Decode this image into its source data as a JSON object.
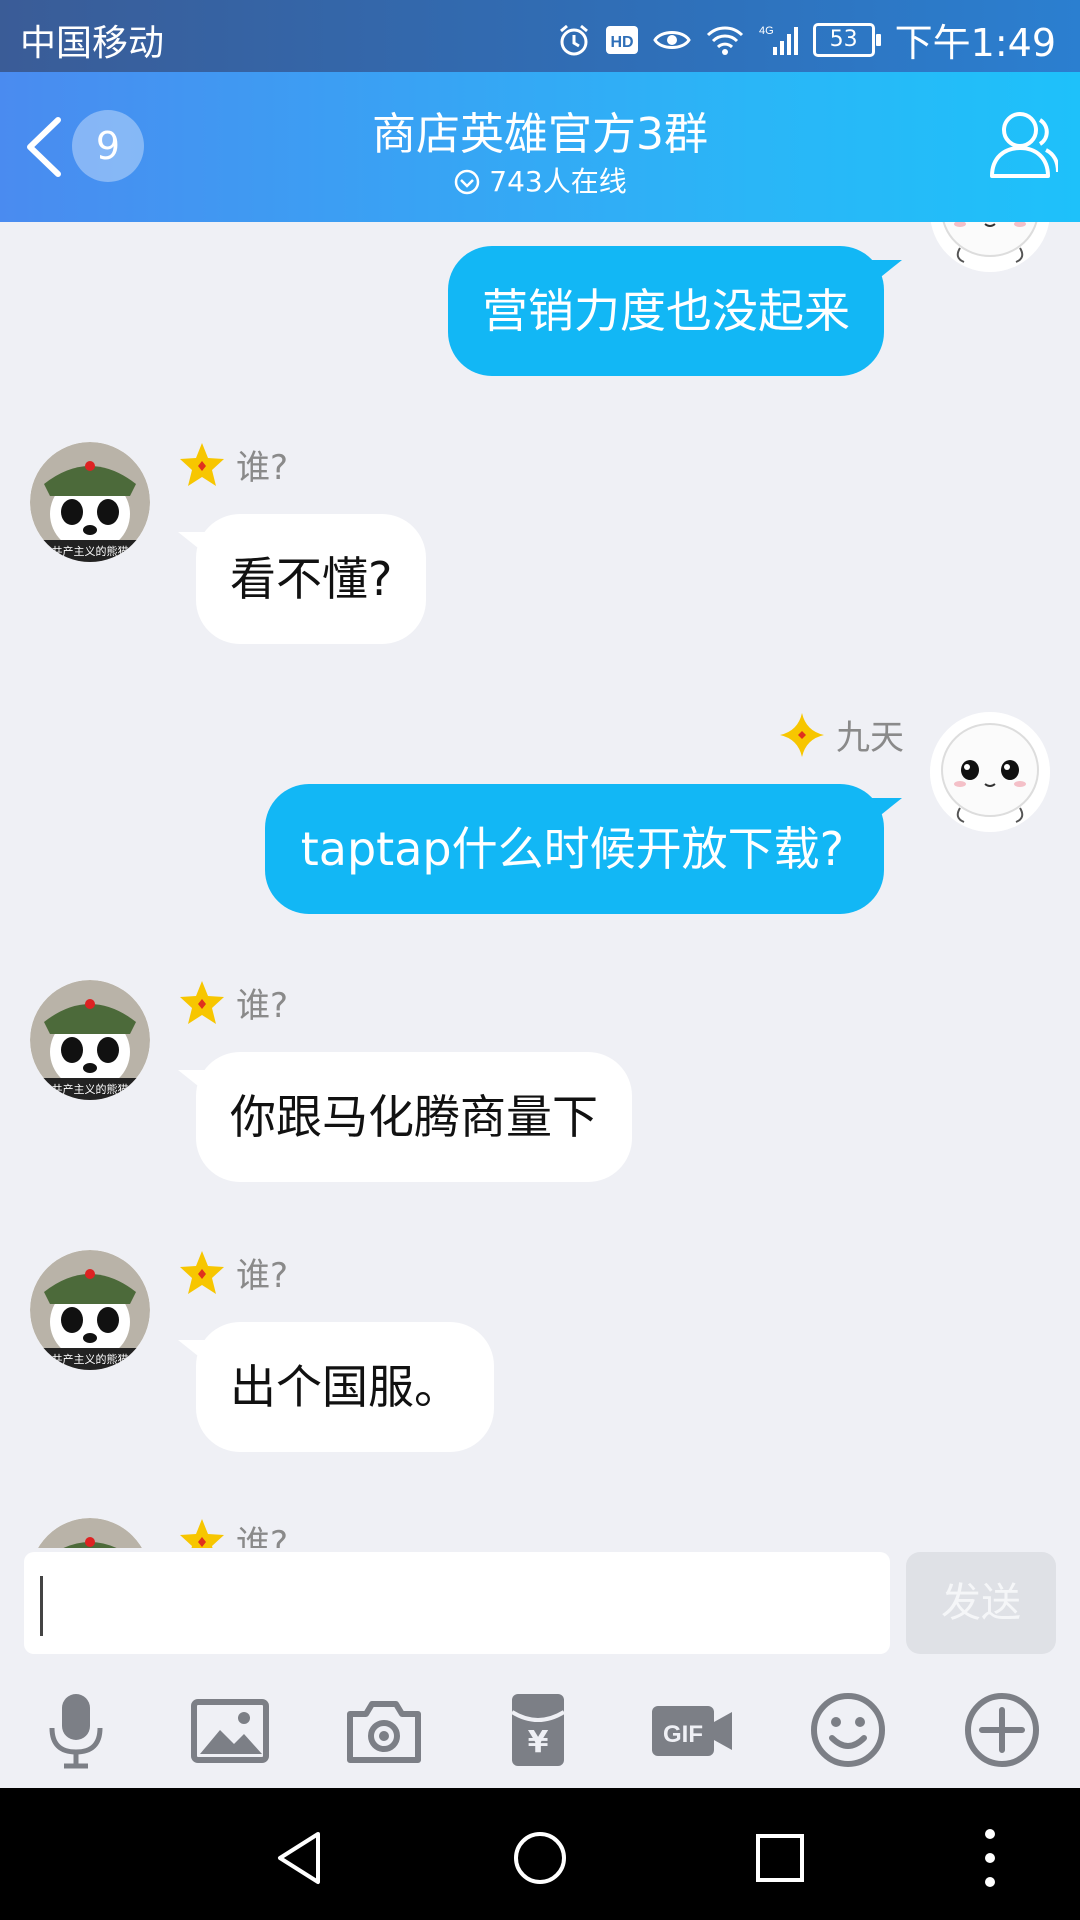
{
  "status_bar": {
    "carrier": "中国移动",
    "battery": "53",
    "time": "下午1:49",
    "network": "4G"
  },
  "header": {
    "back_count": "9",
    "title": "商店英雄官方3群",
    "online": "743人在线"
  },
  "messages": [
    {
      "side": "right",
      "sender": "",
      "text": "营销力度也没起来"
    },
    {
      "side": "left",
      "sender": "谁?",
      "text": "看不懂?"
    },
    {
      "side": "right",
      "sender": "九天",
      "text": "taptap什么时候开放下载?"
    },
    {
      "side": "left",
      "sender": "谁?",
      "text": "你跟马化腾商量下"
    },
    {
      "side": "left",
      "sender": "谁?",
      "text": "出个国服。"
    },
    {
      "side": "left",
      "sender": "谁?",
      "text": ""
    }
  ],
  "input": {
    "value": "",
    "send_label": "发送"
  },
  "toolbar": [
    "microphone-icon",
    "image-icon",
    "camera-icon",
    "red-packet-icon",
    "gif-icon",
    "emoji-icon",
    "plus-icon"
  ],
  "colors": {
    "header_start": "#4a8bf0",
    "header_end": "#1ec1fa",
    "bubble_self": "#12b7f5",
    "background": "#eff0f5"
  }
}
